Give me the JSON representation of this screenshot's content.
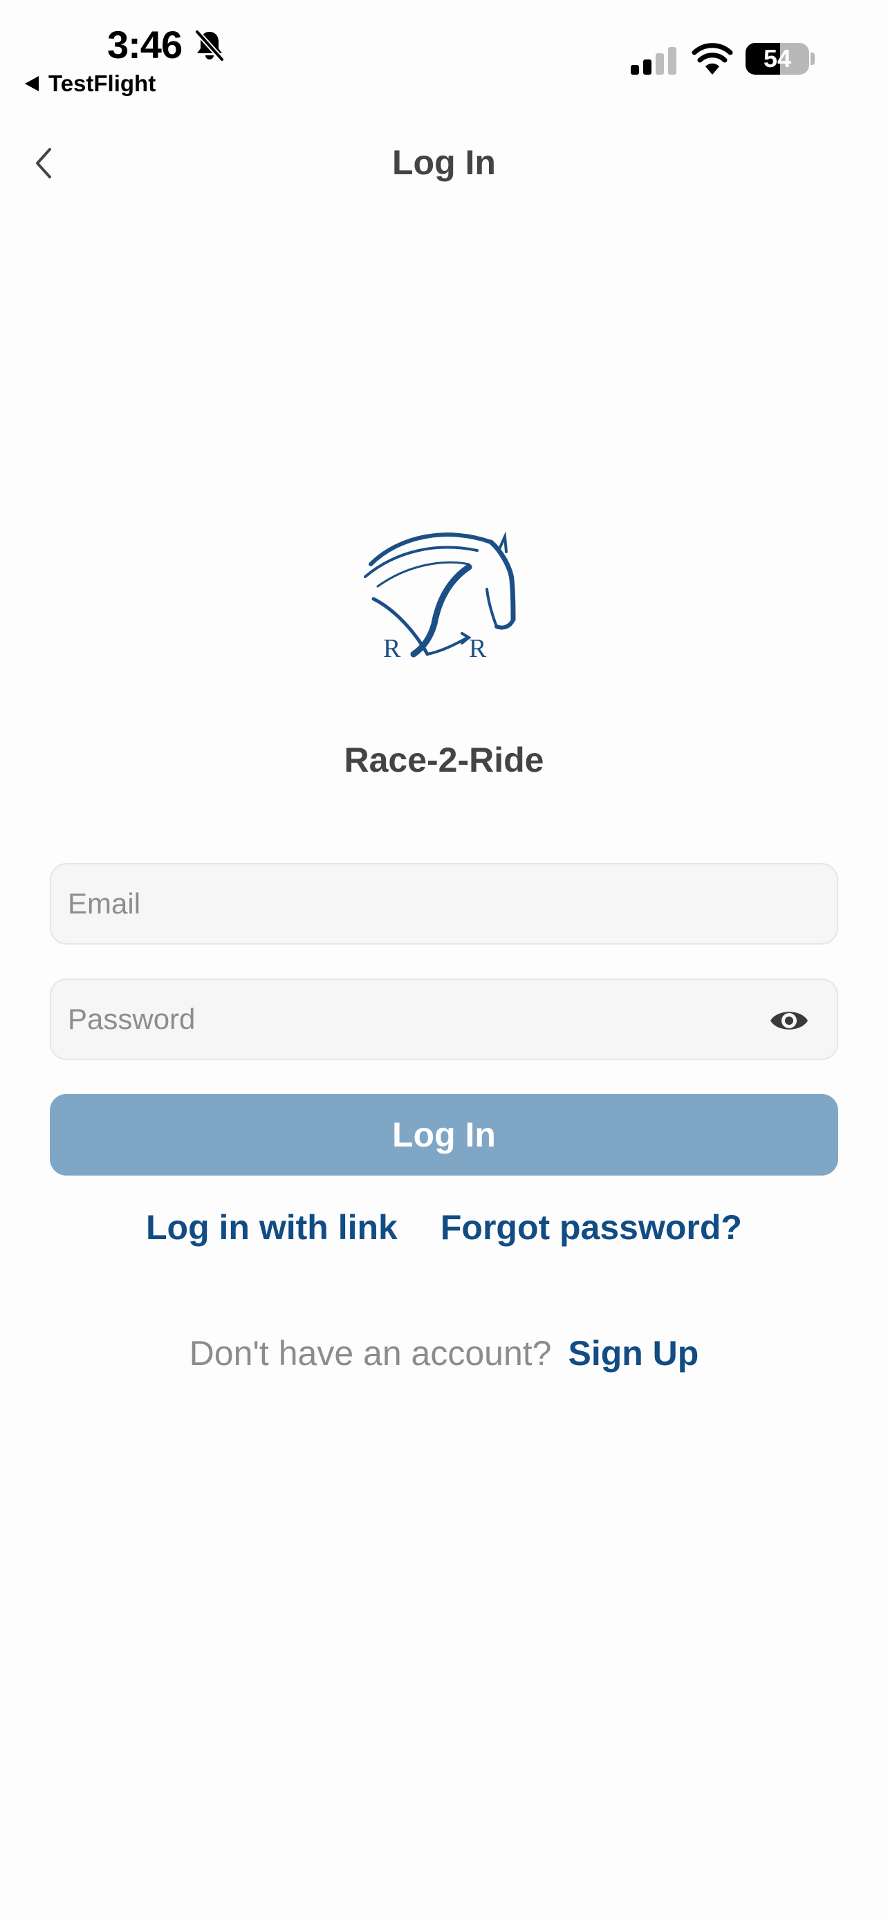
{
  "status_bar": {
    "time": "3:46",
    "back_app": "TestFlight",
    "battery_percent": "54",
    "icons": [
      "bell-slash-icon",
      "cellular-signal-icon",
      "wifi-icon",
      "battery-icon"
    ]
  },
  "nav": {
    "title": "Log In",
    "back_icon": "chevron-left-icon"
  },
  "branding": {
    "app_name": "Race-2-Ride",
    "logo_icon": "horse-head-logo",
    "logo_lettering": "R R"
  },
  "form": {
    "email_placeholder": "Email",
    "email_value": "",
    "password_placeholder": "Password",
    "password_value": "",
    "password_toggle_icon": "eye-icon",
    "login_button": "Log In"
  },
  "links": {
    "login_with_link": "Log in with link",
    "forgot_password": "Forgot password?"
  },
  "signup": {
    "prompt": "Don't have an account?",
    "link": "Sign Up"
  },
  "colors": {
    "brand_blue": "#124c84",
    "button_disabled": "#7fa6c5",
    "input_bg": "#f6f6f6"
  }
}
